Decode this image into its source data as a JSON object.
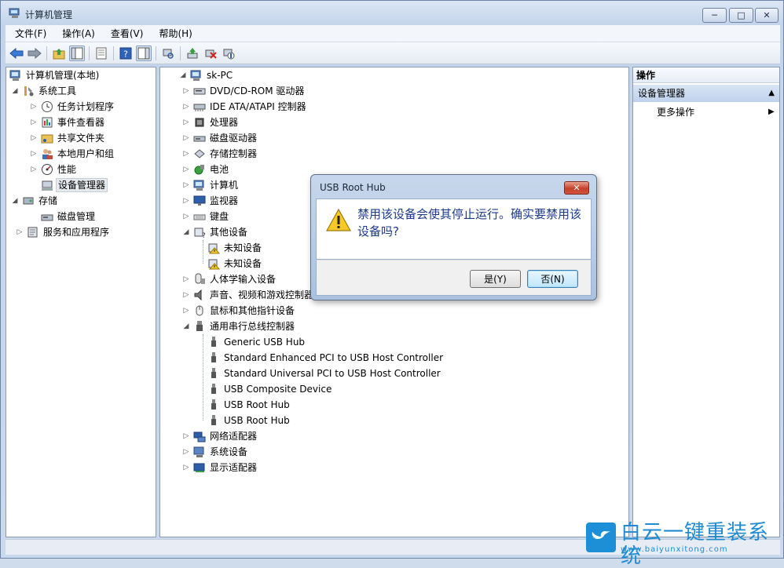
{
  "window": {
    "title": "计算机管理"
  },
  "window_controls": {
    "min": "─",
    "max": "□",
    "close": "✕"
  },
  "menubar": {
    "items": [
      "文件(F)",
      "操作(A)",
      "查看(V)",
      "帮助(H)"
    ]
  },
  "left_tree": {
    "root": "计算机管理(本地)",
    "system_tools": "系统工具",
    "system_tools_children": [
      "任务计划程序",
      "事件查看器",
      "共享文件夹",
      "本地用户和组",
      "性能",
      "设备管理器"
    ],
    "storage": "存储",
    "storage_children": [
      "磁盘管理"
    ],
    "services": "服务和应用程序"
  },
  "device_tree": {
    "root": "sk-PC",
    "categories": [
      {
        "label": "DVD/CD-ROM 驱动器",
        "icon": "dvd-drive-icon",
        "children": []
      },
      {
        "label": "IDE ATA/ATAPI 控制器",
        "icon": "ide-controller-icon",
        "children": []
      },
      {
        "label": "处理器",
        "icon": "processor-icon",
        "children": []
      },
      {
        "label": "磁盘驱动器",
        "icon": "disk-drive-icon",
        "children": []
      },
      {
        "label": "存储控制器",
        "icon": "storage-controller-icon",
        "children": []
      },
      {
        "label": "电池",
        "icon": "battery-icon",
        "children": []
      },
      {
        "label": "计算机",
        "icon": "computer-icon",
        "children": []
      },
      {
        "label": "监视器",
        "icon": "monitor-icon",
        "children": []
      },
      {
        "label": "键盘",
        "icon": "keyboard-icon",
        "children": []
      },
      {
        "label": "其他设备",
        "icon": "other-devices-icon",
        "children": [
          "未知设备",
          "未知设备"
        ]
      },
      {
        "label": "人体学输入设备",
        "icon": "hid-icon",
        "children": []
      },
      {
        "label": "声音、视频和游戏控制器",
        "icon": "sound-icon",
        "children": []
      },
      {
        "label": "鼠标和其他指针设备",
        "icon": "mouse-icon",
        "children": []
      },
      {
        "label": "通用串行总线控制器",
        "icon": "usb-icon",
        "children": [
          "Generic USB Hub",
          "Standard Enhanced PCI to USB Host Controller",
          "Standard Universal PCI to USB Host Controller",
          "USB Composite Device",
          "USB Root Hub",
          "USB Root Hub"
        ]
      },
      {
        "label": "网络适配器",
        "icon": "network-adapter-icon",
        "children": []
      },
      {
        "label": "系统设备",
        "icon": "system-devices-icon",
        "children": []
      },
      {
        "label": "显示适配器",
        "icon": "display-adapter-icon",
        "children": []
      }
    ]
  },
  "actions_pane": {
    "header": "操作",
    "section": "设备管理器",
    "more": "更多操作"
  },
  "dialog": {
    "title": "USB Root Hub",
    "close": "✕",
    "message": "禁用该设备会使其停止运行。确实要禁用该设备吗?",
    "yes": "是(Y)",
    "no": "否(N)"
  },
  "watermark": {
    "text": "白云一键重装系统",
    "url": "www.baiyunxitong.com"
  }
}
